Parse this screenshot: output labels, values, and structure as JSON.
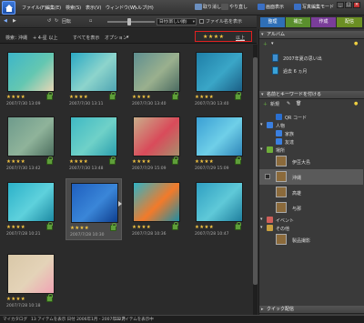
{
  "menubar": {
    "items": [
      "ファイル(F)",
      "編集(E)",
      "検索(S)",
      "表示(V)",
      "ウィンドウ(W)",
      "ヘルプ(H)"
    ],
    "tools": [
      "取り消し",
      "やり直し",
      "画面表示",
      "写真編集モード"
    ]
  },
  "toolbar": {
    "rotate_label": "回転",
    "sort_value": "日付(新しい順)",
    "filename_label": "ファイル名を表示"
  },
  "modes": {
    "organize": "整理",
    "fix": "補正",
    "create": "作成",
    "share": "配信"
  },
  "filterbar": {
    "search_label": "検索：",
    "search_value": "沖縄",
    "search_extra": "+ 4-星 以上",
    "show_all": "すべてを表示",
    "options": "オプション",
    "rating_stars": "★★★★",
    "rating_label": "以上"
  },
  "photos": [
    {
      "stars": "★★★★",
      "date": "2007/7/30 13:09",
      "colors": [
        "#3db6c9",
        "#64c7b1",
        "#e7d6b5"
      ]
    },
    {
      "stars": "★★★★",
      "date": "2007/7/30 13:11",
      "colors": [
        "#2aa9c4",
        "#8dd4cc",
        "#4fa5b3"
      ]
    },
    {
      "stars": "★★★★",
      "date": "2007/7/30 13:40",
      "colors": [
        "#5f8f90",
        "#9ab08e",
        "#4b6b61"
      ]
    },
    {
      "stars": "★★★★",
      "date": "2007/7/30 13:40",
      "colors": [
        "#1f7fa8",
        "#3aa6c7",
        "#1b5f86"
      ]
    },
    {
      "stars": "★★★★",
      "date": "2007/7/30 13:42",
      "colors": [
        "#6e9b8c",
        "#8fb39a",
        "#4e7060"
      ]
    },
    {
      "stars": "★★★★",
      "date": "2007/7/30 13:48",
      "colors": [
        "#3fb9c4",
        "#6fd1c8",
        "#2b9fae"
      ]
    },
    {
      "stars": "★★★★",
      "date": "2007/7/29 15:09",
      "colors": [
        "#c9ae8a",
        "#d94b5a",
        "#a88f6d"
      ]
    },
    {
      "stars": "★★★★",
      "date": "2007/7/29 15:09",
      "colors": [
        "#3a9fd4",
        "#6fcfe8",
        "#2f86b9"
      ]
    },
    {
      "stars": "★★★★",
      "date": "2007/7/28 10:21",
      "colors": [
        "#2cb1c9",
        "#5ed1dc",
        "#1d8aa3"
      ]
    },
    {
      "stars": "★★★★",
      "date": "2007/7/28 10:30",
      "colors": [
        "#1f5fbf",
        "#3a86d8",
        "#0f3f8f"
      ]
    },
    {
      "stars": "★★★★",
      "date": "2007/7/28 10:36",
      "colors": [
        "#2fb3c6",
        "#f27a2a",
        "#1e8ea5"
      ]
    },
    {
      "stars": "★★★★",
      "date": "2007/7/28 10:47",
      "colors": [
        "#2f9fc2",
        "#5fc9d8",
        "#1f7f9e"
      ]
    },
    {
      "stars": "★★★★",
      "date": "2007/7/28 10:18",
      "colors": [
        "#d9c8a8",
        "#e4d3b8",
        "#f0a3b4"
      ]
    }
  ],
  "panel": {
    "album_header": "アルバム",
    "albums": [
      "2007年夏の思い出",
      "過去 6 ヵ月"
    ],
    "tags_header": "名前とキーワードを付ける",
    "new_label": "新規",
    "tags": [
      {
        "label": "QR コード",
        "level": 1
      },
      {
        "label": "人物",
        "level": 0
      },
      {
        "label": "家族",
        "level": 1
      },
      {
        "label": "友達",
        "level": 1
      },
      {
        "label": "場所",
        "level": 0
      },
      {
        "label": "伊豆大島",
        "level": 1
      },
      {
        "label": "沖縄",
        "level": 1
      },
      {
        "label": "高雄",
        "level": 1
      },
      {
        "label": "与那",
        "level": 1
      },
      {
        "label": "イベント",
        "level": 0
      },
      {
        "label": "その他",
        "level": 0
      },
      {
        "label": "製品撮影",
        "level": 1
      }
    ],
    "quick_share_header": "クイック配信"
  },
  "status": {
    "text1": "マイカタログ",
    "text2": "13 アイテムを表示 日付 2006年1月 - 2007年12月",
    "text3": "13 アイテムを表示中"
  }
}
